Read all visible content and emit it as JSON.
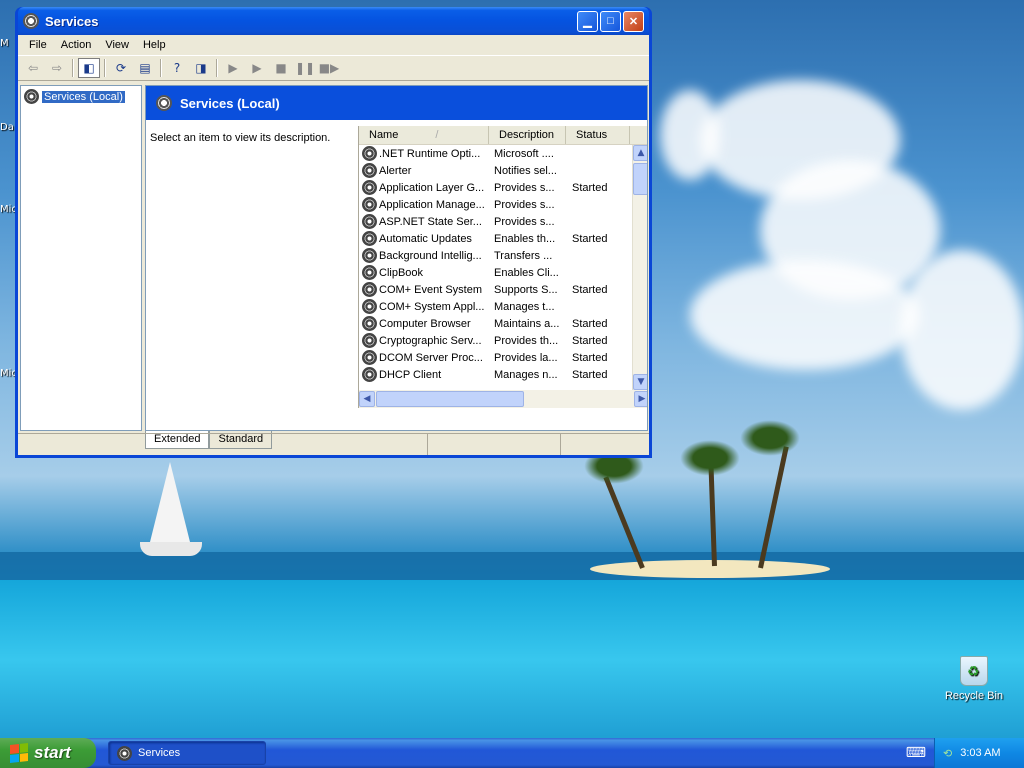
{
  "desktop": {
    "edge_labels": [
      "M",
      "Da",
      "Mic",
      "Mic"
    ],
    "recycle_bin_label": "Recycle Bin"
  },
  "window": {
    "title": "Services",
    "menu": [
      "File",
      "Action",
      "View",
      "Help"
    ],
    "tree": {
      "root_label": "Services (Local)"
    },
    "header_title": "Services (Local)",
    "description_prompt": "Select an item to view its description.",
    "columns": {
      "name": "Name",
      "sort_indicator": "/",
      "description": "Description",
      "status": "Status"
    },
    "services": [
      {
        "name": ".NET Runtime Opti...",
        "description": "Microsoft ....",
        "status": ""
      },
      {
        "name": "Alerter",
        "description": "Notifies sel...",
        "status": ""
      },
      {
        "name": "Application Layer G...",
        "description": "Provides s...",
        "status": "Started"
      },
      {
        "name": "Application Manage...",
        "description": "Provides s...",
        "status": ""
      },
      {
        "name": "ASP.NET State Ser...",
        "description": "Provides s...",
        "status": ""
      },
      {
        "name": "Automatic Updates",
        "description": "Enables th...",
        "status": "Started"
      },
      {
        "name": "Background Intellig...",
        "description": "Transfers ...",
        "status": ""
      },
      {
        "name": "ClipBook",
        "description": "Enables Cli...",
        "status": ""
      },
      {
        "name": "COM+ Event System",
        "description": "Supports S...",
        "status": "Started"
      },
      {
        "name": "COM+ System Appl...",
        "description": "Manages t...",
        "status": ""
      },
      {
        "name": "Computer Browser",
        "description": "Maintains a...",
        "status": "Started"
      },
      {
        "name": "Cryptographic Serv...",
        "description": "Provides th...",
        "status": "Started"
      },
      {
        "name": "DCOM Server Proc...",
        "description": "Provides la...",
        "status": "Started"
      },
      {
        "name": "DHCP Client",
        "description": "Manages n...",
        "status": "Started"
      }
    ],
    "tabs": [
      "Extended",
      "Standard"
    ]
  },
  "taskbar": {
    "start_label": "start",
    "task_label": "Services",
    "clock": "3:03 AM"
  },
  "colors": {
    "title_blue": "#0553e0",
    "start_green": "#3c9c36",
    "selection": "#316ac5"
  }
}
